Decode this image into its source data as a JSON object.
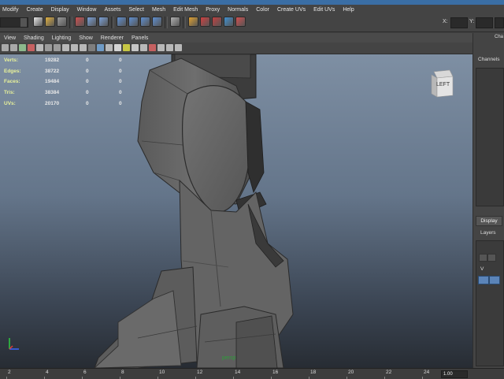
{
  "menu": [
    "Modify",
    "Create",
    "Display",
    "Window",
    "Assets",
    "Select",
    "Mesh",
    "Edit Mesh",
    "Proxy",
    "Normals",
    "Color",
    "Create UVs",
    "Edit UVs",
    "Help"
  ],
  "toolbar": {
    "x_label": "X:",
    "y_label": "Y:",
    "icons": [
      "new-scene-icon",
      "open-scene-icon",
      "save-scene-icon",
      "select-hierarchy-icon",
      "select-object-icon",
      "select-component-icon",
      "snap-grid-icon",
      "snap-curve-icon",
      "snap-point-icon",
      "snap-plane-icon",
      "history-icon",
      "render-icon",
      "ipr-render-icon",
      "render-settings-icon",
      "sculpt-icon",
      "magnet-icon"
    ]
  },
  "panel_menu": [
    "View",
    "Shading",
    "Lighting",
    "Show",
    "Renderer",
    "Panels"
  ],
  "hud": {
    "rows": [
      {
        "label": "Verts:",
        "value": "19282",
        "c1": "0",
        "c2": "0"
      },
      {
        "label": "Edges:",
        "value": "38722",
        "c1": "0",
        "c2": "0"
      },
      {
        "label": "Faces:",
        "value": "19484",
        "c1": "0",
        "c2": "0"
      },
      {
        "label": "Tris:",
        "value": "38384",
        "c1": "0",
        "c2": "0"
      },
      {
        "label": "UVs:",
        "value": "20170",
        "c1": "0",
        "c2": "0"
      }
    ]
  },
  "viewcube_label": "LEFT",
  "camera_label": "persp",
  "right_panel": {
    "tab": "Cha",
    "channels_title": "Channels",
    "display_tab": "Display",
    "layers_label": "Layers",
    "layer_check": "V"
  },
  "timeline": {
    "ticks": [
      "2",
      "4",
      "6",
      "8",
      "10",
      "12",
      "14",
      "16",
      "18",
      "20",
      "22",
      "24"
    ],
    "current_frame": "1.00"
  },
  "colors": {
    "hud_label": "#e9f29a",
    "viewport_top": "#7e8fa3",
    "viewport_bottom": "#272c33",
    "camera_label": "#2e9d3a"
  }
}
